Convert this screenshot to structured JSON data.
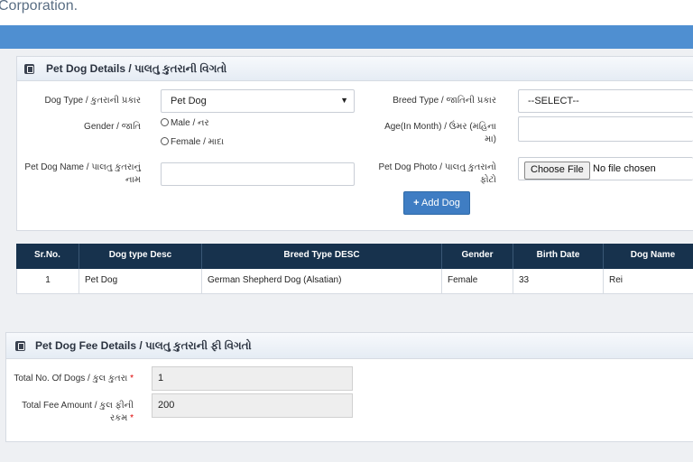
{
  "header": {
    "corp_text": "Corporation."
  },
  "dog_details": {
    "title": "Pet Dog Details / પાલતુ કુતરાની વિગતો",
    "dog_type_label": "Dog Type / કુતરાની પ્રકાર",
    "dog_type_value": "Pet Dog",
    "breed_type_label": "Breed Type / જાતિની પ્રકાર",
    "breed_type_value": "--SELECT--",
    "gender_label": "Gender / જાતિ",
    "gender_male": "Male / નર",
    "gender_female": "Female / માદા",
    "age_label": "Age(In Month) / ઉંમર (મહિના",
    "age_label2": "મા)",
    "name_label": "Pet Dog Name / પાલતુ કુતરાનું",
    "name_label2": "નામ",
    "photo_label": "Pet Dog Photo / પાલતુ કુતરાનો",
    "photo_label2": "ફોટો",
    "choose_file": "Choose File",
    "no_file": "No file chosen",
    "add_dog": "Add Dog"
  },
  "dogs_table": {
    "columns": [
      "Sr.No.",
      "Dog type Desc",
      "Breed Type DESC",
      "Gender",
      "Birth Date",
      "Dog Name"
    ],
    "rows": [
      [
        "1",
        "Pet Dog",
        "German Shepherd Dog (Alsatian)",
        "Female",
        "33",
        "Rei"
      ]
    ]
  },
  "fee_details": {
    "title": "Pet Dog Fee Details / પાલતુ કુતરાની ફી વિગતો",
    "total_dogs_label": "Total No. Of Dogs / કુલ કુતરા",
    "total_dogs_value": "1",
    "total_fee_label": "Total Fee Amount / કુલ ફીની",
    "total_fee_label2": "રકમ",
    "total_fee_value": "200",
    "required_mark": "*"
  }
}
